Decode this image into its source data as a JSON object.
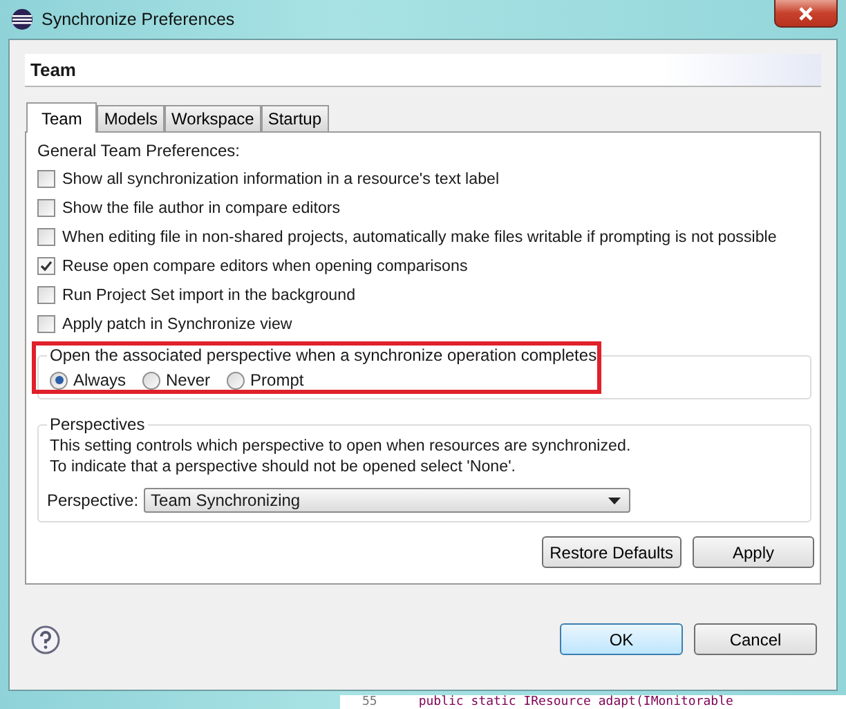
{
  "window": {
    "title": "Synchronize Preferences"
  },
  "page_title": "Team",
  "tabs": [
    {
      "label": "Team",
      "selected": true
    },
    {
      "label": "Models",
      "selected": false
    },
    {
      "label": "Workspace",
      "selected": false
    },
    {
      "label": "Startup",
      "selected": false
    }
  ],
  "section_label": "General Team Preferences:",
  "options": [
    {
      "label": "Show all synchronization information in a resource's text label",
      "checked": false
    },
    {
      "label": "Show the file author in compare editors",
      "checked": false
    },
    {
      "label": "When editing file in non-shared projects, automatically make files writable if prompting is not possible",
      "checked": false
    },
    {
      "label": "Reuse open compare editors when opening comparisons",
      "checked": true
    },
    {
      "label": "Run Project Set import in the background",
      "checked": false
    },
    {
      "label": "Apply patch in Synchronize view",
      "checked": false
    }
  ],
  "open_perspective": {
    "title": "Open the associated perspective when a synchronize operation completes",
    "choices": [
      {
        "label": "Always",
        "selected": true
      },
      {
        "label": "Never",
        "selected": false
      },
      {
        "label": "Prompt",
        "selected": false
      }
    ]
  },
  "perspectives": {
    "title": "Perspectives",
    "description": [
      "This setting controls which perspective to open when resources are synchronized.",
      "To indicate that a perspective should not be opened select 'None'."
    ],
    "field_label": "Perspective:",
    "value": "Team Synchronizing"
  },
  "panel_buttons": [
    "Restore Defaults",
    "Apply"
  ],
  "dialog_buttons": [
    "OK",
    "Cancel"
  ],
  "editor_behind": {
    "line_number": "55",
    "code": "public static IResource adapt(IMonitorable"
  }
}
